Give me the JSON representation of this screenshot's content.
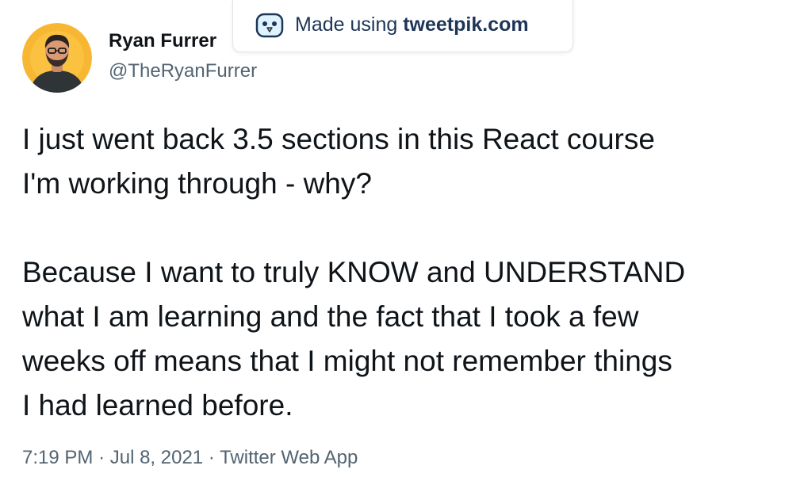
{
  "watermark": {
    "prefix": "Made using",
    "site": "tweetpik.com",
    "icon": "bird-logo-icon"
  },
  "tweet": {
    "author": {
      "display_name": "Ryan Furrer",
      "handle": "@TheRyanFurrer",
      "avatar_bg": "#f7b733"
    },
    "paragraphs": [
      "I just went back 3.5 sections in this React course\nI'm working through - why?",
      "Because I want to truly KNOW and UNDERSTAND\nwhat I am learning and the fact that I took a few\nweeks off means that I might not remember things\nI had learned before."
    ],
    "time": "7:19 PM",
    "date": "Jul 8, 2021",
    "source": "Twitter Web App",
    "separator": "·"
  },
  "colors": {
    "text": "#0f1419",
    "secondary": "#536471",
    "watermark_text": "#1d3557"
  }
}
